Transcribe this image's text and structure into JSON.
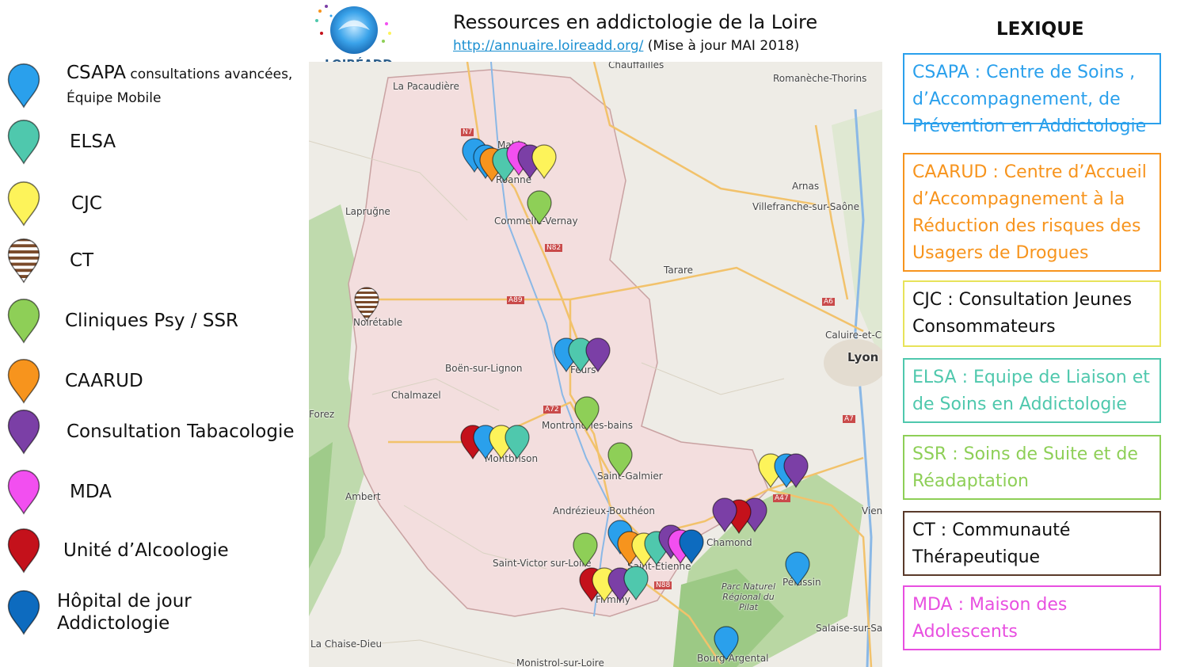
{
  "header": {
    "title": "Ressources en addictologie de la Loire",
    "url": "http://annuaire.loireadd.org/",
    "update": "(Mise à jour MAI 2018)",
    "logo_text": "LOIRÉADD"
  },
  "legend": [
    {
      "main": "CSAPA",
      "small": " consultations avancées,",
      "line2": "Équipe Mobile",
      "color": "#2aa0ec",
      "pattern": "solid"
    },
    {
      "main": "ELSA",
      "small": "",
      "line2": "",
      "color": "#4fc8ad",
      "pattern": "solid"
    },
    {
      "main": "CJC",
      "small": "",
      "line2": "",
      "color": "#fdf35a",
      "pattern": "solid"
    },
    {
      "main": "CT",
      "small": "",
      "line2": "",
      "color": "#7a4a2a",
      "pattern": "stripes"
    },
    {
      "main": "Cliniques Psy / SSR",
      "small": "",
      "line2": "",
      "color": "#8ecf57",
      "pattern": "solid"
    },
    {
      "main": "CAARUD",
      "small": "",
      "line2": "",
      "color": "#f7941d",
      "pattern": "solid"
    },
    {
      "main": "Consultation Tabacologie",
      "small": "",
      "line2": "",
      "color": "#7b3fa6",
      "pattern": "solid"
    },
    {
      "main": "MDA",
      "small": "",
      "line2": "",
      "color": "#f24ff0",
      "pattern": "solid"
    },
    {
      "main": "Unité d’Alcoologie",
      "small": "",
      "line2": "",
      "color": "#c4111b",
      "pattern": "solid"
    },
    {
      "main": "Hôpital de jour Addictologie",
      "small": "",
      "line2": "",
      "color": "#0d6bbf",
      "pattern": "solid"
    }
  ],
  "lexique": {
    "title": "LEXIQUE",
    "items": [
      {
        "text": "CSAPA : Centre de Soins , d’Accompagnement, de Prévention en Addictologie",
        "color": "#2aa0ec"
      },
      {
        "text": "CAARUD : Centre d’Accueil d’Accompagnement à la Réduction des risques des Usagers de Drogues",
        "color": "#f7941d"
      },
      {
        "text": "CJC : Consultation Jeunes Consommateurs",
        "color": "#e8e35a",
        "textcolor": "#111"
      },
      {
        "text": "ELSA : Equipe de Liaison et de Soins en Addictologie",
        "color": "#4fc8ad"
      },
      {
        "text": "SSR : Soins de Suite et de Réadaptation",
        "color": "#8ecf57"
      },
      {
        "text": "CT : Communauté Thérapeutique",
        "color": "#5a3a2a",
        "textcolor": "#111"
      },
      {
        "text": "MDA : Maison des Adolescents",
        "color": "#e84fe0"
      }
    ]
  },
  "map": {
    "places": [
      "Chauffailles",
      "La Pacaudière",
      "Mably",
      "Roanne",
      "Romanèche-Thorins",
      "Lapruğne",
      "Commelle-Vernay",
      "Arnas",
      "Villefranche-sur-Saône",
      "Tarare",
      "Noirétable",
      "Caluire-et-C",
      "Lyon",
      "Boën-sur-Lignon",
      "Feurs",
      "Chalmazel",
      "Montrond-les-bains",
      "Montbrison",
      "Saint-Galmier",
      "Ambert",
      "Andrézieux-Bouthéon",
      "Chamond",
      "Saint-Victor sur-Loire",
      "Saint-Étienne",
      "Firminy",
      "Pélussin",
      "Parc Naturel Régional du Pilat",
      "La Chaise-Dieu",
      "Bourg-Argental",
      "Monistrol-sur-Loire",
      "Salaise-sur-Sanne",
      "Vienne",
      "Forez",
      "N7",
      "N82",
      "A89",
      "A72",
      "A6",
      "A47",
      "N88",
      "A7"
    ]
  }
}
